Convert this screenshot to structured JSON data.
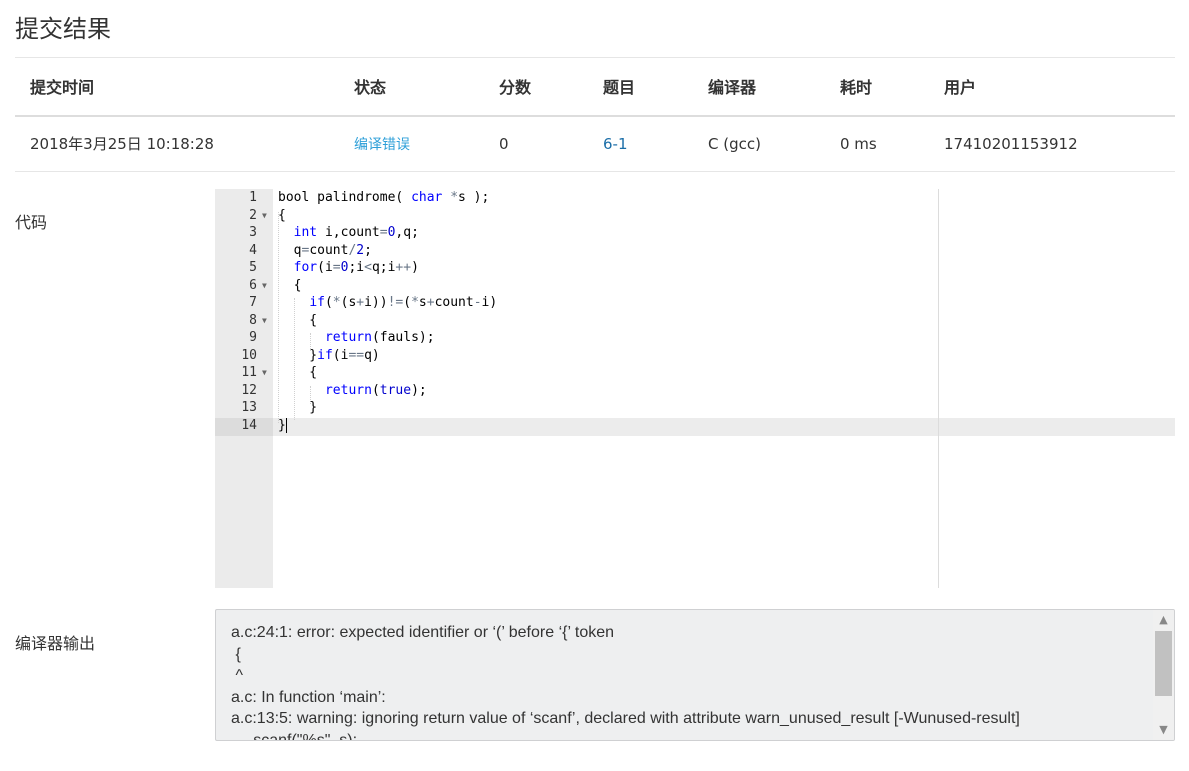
{
  "page": {
    "title": "提交结果"
  },
  "table": {
    "headers": {
      "time": "提交时间",
      "status": "状态",
      "score": "分数",
      "problem": "题目",
      "compiler": "编译器",
      "cost": "耗时",
      "user": "用户"
    },
    "row": {
      "time": "2018年3月25日 10:18:28",
      "status": "编译错误",
      "score": "0",
      "problem": "6-1",
      "compiler": "C (gcc)",
      "cost": "0 ms",
      "user": "17410201153912"
    }
  },
  "code": {
    "label": "代码",
    "line_numbers": [
      "1",
      "2",
      "3",
      "4",
      "5",
      "6",
      "7",
      "8",
      "9",
      "10",
      "11",
      "12",
      "13",
      "14"
    ],
    "fold_icon": "fold-arrow-icon"
  },
  "compiler_output": {
    "label": "编译器输出",
    "lines": [
      "a.c:24:1: error: expected identifier or ‘(’ before ‘{’ token",
      " {",
      " ^",
      "a.c: In function ‘main’:",
      "a.c:13:5: warning: ignoring return value of ‘scanf’, declared with attribute warn_unused_result [-Wunused-result]",
      "     scanf(\"%s\", s);"
    ]
  },
  "colors": {
    "status_link": "#2d9fd8",
    "problem_link": "#1b6ea8",
    "keyword": "#0000ff",
    "gutter": "#ebebeb"
  }
}
